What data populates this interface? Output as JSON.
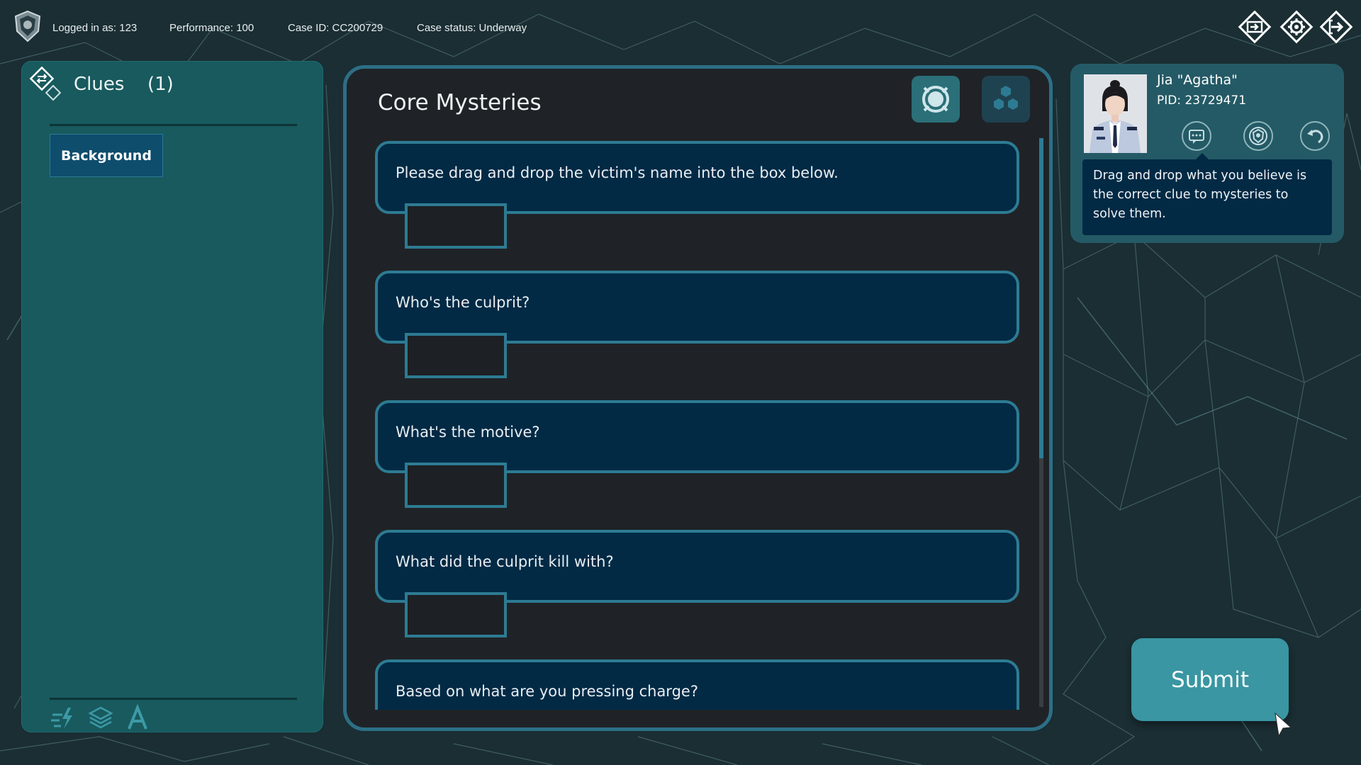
{
  "colors": {
    "accent": "#2d7b93",
    "panel_teal": "#185a5e",
    "question_bg": "#022a45",
    "submit_bg": "#3996a2",
    "main_bg": "#1f2327"
  },
  "topbar": {
    "logged_in": "Logged in as: 123",
    "performance": "Performance: 100",
    "case_id": "Case ID: CC200729",
    "case_status": "Case status: Underway",
    "buttons": [
      "case-file-icon",
      "settings-gear-icon",
      "exit-icon"
    ]
  },
  "clues": {
    "title": "Clues",
    "count": "(1)",
    "items": [
      {
        "label": "Background"
      }
    ],
    "tools": [
      "flash-edit-icon",
      "layers-icon",
      "font-icon"
    ]
  },
  "mysteries": {
    "title": "Core Mysteries",
    "modes": [
      "target-mode-icon",
      "cluster-mode-icon"
    ],
    "questions": [
      {
        "text": "Please drag and drop the victim's name into the box below."
      },
      {
        "text": "Who's the culprit?"
      },
      {
        "text": "What's the motive?"
      },
      {
        "text": "What did the culprit kill with?"
      },
      {
        "text": "Based on what are you pressing charge?"
      }
    ]
  },
  "character": {
    "name": "Jia \"Agatha\"",
    "pid": "PID: 23729471",
    "actions": [
      "chat-icon",
      "police-badge-icon",
      "undo-icon"
    ],
    "tip": "Drag and drop what you believe is the correct clue to mysteries to solve them."
  },
  "submit": {
    "label": "Submit"
  }
}
